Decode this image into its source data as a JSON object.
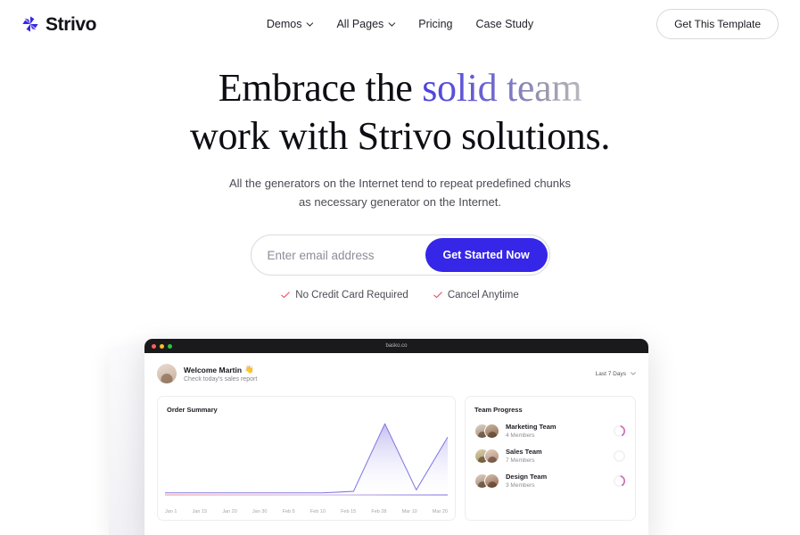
{
  "brand": {
    "name": "Strivo",
    "icon": "pinwheel-logo-icon",
    "color": "#3626e7"
  },
  "nav": {
    "items": [
      {
        "label": "Demos",
        "has_dropdown": true
      },
      {
        "label": "All Pages",
        "has_dropdown": true
      },
      {
        "label": "Pricing",
        "has_dropdown": false
      },
      {
        "label": "Case Study",
        "has_dropdown": false
      }
    ],
    "cta_label": "Get This Template"
  },
  "hero": {
    "headline_line1_plain": "Embrace the ",
    "headline_line1_accent": "solid team",
    "headline_line2": "work with Strivo solutions.",
    "subhead_line1": "All the generators on the Internet tend to repeat predefined chunks",
    "subhead_line2": "as necessary generator on the Internet.",
    "accent_gradient_from": "#4a41e0",
    "accent_gradient_to": "#b9b8bf"
  },
  "signup": {
    "email_placeholder": "Enter email address",
    "email_value": "",
    "button_label": "Get Started Now",
    "button_color": "#3626e7",
    "assurances": [
      {
        "label": "No Credit Card Required",
        "icon": "check-icon"
      },
      {
        "label": "Cancel Anytime",
        "icon": "check-icon"
      }
    ],
    "assurance_icon_color": "#ef5a72"
  },
  "dashboard": {
    "browser_url": "basko.co",
    "greeting": "Welcome Martin",
    "greeting_emoji": "👋",
    "greeting_sub": "Check today's sales report",
    "range_label": "Last 7 Days",
    "order_card": {
      "title": "Order Summary"
    },
    "team_card": {
      "title": "Team Progress",
      "teams": [
        {
          "name": "Marketing Team",
          "members": "4 Members",
          "progress": 35
        },
        {
          "name": "Sales Team",
          "members": "7 Members",
          "progress": 0
        },
        {
          "name": "Design Team",
          "members": "3 Members",
          "progress": 35
        }
      ]
    }
  },
  "chart_data": {
    "type": "area",
    "title": "Order Summary",
    "categories": [
      "Jan 1",
      "Jan 15",
      "Jan 20",
      "Jan 30",
      "Feb 5",
      "Feb 10",
      "Feb 15",
      "Feb 28",
      "Mar 10",
      "Mar 20"
    ],
    "values": [
      2,
      2,
      2,
      2,
      2,
      2,
      4,
      96,
      6,
      78
    ],
    "xlabel": "",
    "ylabel": "",
    "ylim": [
      0,
      100
    ],
    "grid": false,
    "legend": false,
    "line_color": "#8179e0",
    "fill_gradient_from": "#b9b3ef",
    "fill_gradient_to": "#ffffff",
    "baseline_gradient_from": "#f3a9b6",
    "baseline_gradient_to": "#9a90e8"
  }
}
